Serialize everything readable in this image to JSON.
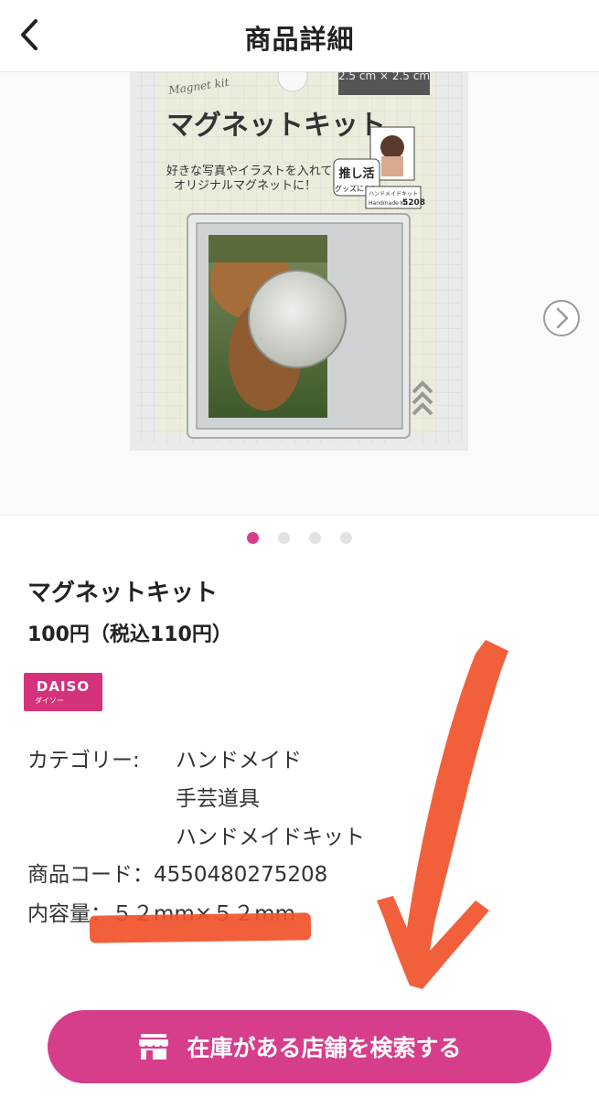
{
  "header": {
    "title": "商品詳細"
  },
  "gallery": {
    "package_header": "Magnet kit",
    "package_title": "マグネットキット",
    "package_desc1": "好きな写真やイラストを入れて",
    "package_desc2": "オリジナルマグネットに！",
    "badge_main": "推し活",
    "badge_sub": "グッズにも！",
    "badge_code_label": "ハンドメイドキット",
    "badge_code": "5208",
    "badge_handmade": "Handmade Kit",
    "size_text": "2.5 cm × 2.5 cm",
    "total_images": 4,
    "active_image": 1
  },
  "product": {
    "name": "マグネットキット",
    "price": "100円（税込110円）",
    "brand": {
      "main": "DAISO",
      "sub": "ダイソー"
    },
    "category_label": "カテゴリー:",
    "categories": [
      "ハンドメイド",
      "手芸道具",
      "ハンドメイドキット"
    ],
    "code_label": "商品コード：",
    "code_value": "4550480275208",
    "size_label": "内容量：",
    "size_value": "５２mm×５２mm"
  },
  "cta": {
    "label": "在庫がある店舗を検索する"
  },
  "colors": {
    "accent": "#d63d8b",
    "brand": "#d4327a",
    "annotation": "#f0522a"
  },
  "icons": [
    "chevron-left-icon",
    "chevron-right-icon",
    "store-icon"
  ]
}
